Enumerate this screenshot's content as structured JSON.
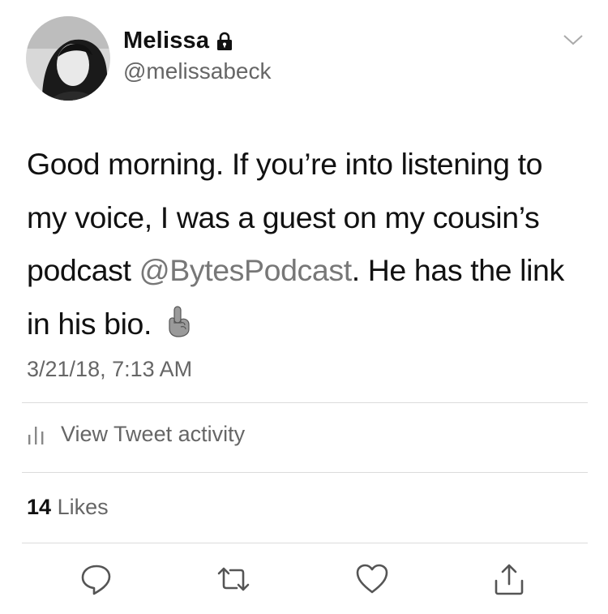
{
  "user": {
    "name": "Melissa",
    "handle": "@melissabeck"
  },
  "tweet": {
    "text_before": "Good morning. If you’re into listening to my voice, I was a guest on my cousin’s podcast ",
    "mention": "@BytesPodcast",
    "text_after": ". He has the link in his bio. ",
    "emoji": "☝️",
    "timestamp": "3/21/18, 7:13 AM"
  },
  "activity": {
    "label": "View Tweet activity"
  },
  "likes": {
    "count": "14",
    "label": "Likes"
  },
  "icons": {
    "avatar": "avatar-photo",
    "lock": "lock-icon",
    "menu": "chevron-down-icon",
    "activity": "bar-chart-icon",
    "reply": "reply-icon",
    "retweet": "retweet-icon",
    "like": "heart-icon",
    "share": "share-icon"
  }
}
